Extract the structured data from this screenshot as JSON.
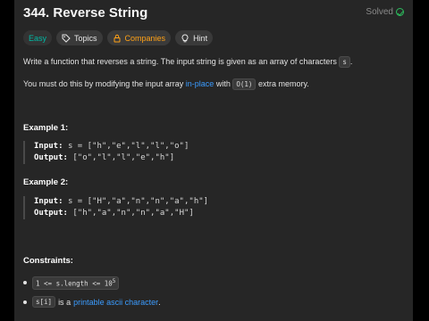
{
  "problem": {
    "title": "344. Reverse String",
    "status": "Solved"
  },
  "tags": {
    "difficulty": "Easy",
    "topics": "Topics",
    "companies": "Companies",
    "hint": "Hint"
  },
  "description": {
    "p1_text": "Write a function that reverses a string. The input string is given as an array of characters",
    "p1_code": "s",
    "p1_end": ".",
    "p2_text": "You must do this by modifying the input array",
    "p2_link": "in-place",
    "p2_mid": "with",
    "p2_code": "O(1)",
    "p2_end": "extra memory."
  },
  "examples": [
    {
      "title": "Example 1:",
      "input_label": "Input:",
      "input_value": "s = [\"h\",\"e\",\"l\",\"l\",\"o\"]",
      "output_label": "Output:",
      "output_value": "[\"o\",\"l\",\"l\",\"e\",\"h\"]"
    },
    {
      "title": "Example 2:",
      "input_label": "Input:",
      "input_value": "s = [\"H\",\"a\",\"n\",\"n\",\"a\",\"h\"]",
      "output_label": "Output:",
      "output_value": "[\"h\",\"a\",\"n\",\"n\",\"a\",\"H\"]"
    }
  ],
  "constraints": {
    "title": "Constraints:",
    "c1_code_base": "1 <= s.length <= 10",
    "c1_code_exp": "5",
    "c2_code": "s[i]",
    "c2_text": "is a",
    "c2_link": "printable ascii character",
    "c2_end": "."
  },
  "colors": {
    "accent_easy": "#00b8a3",
    "accent_companies": "#ffa116",
    "solved": "#2cbb5d",
    "link": "#3b9cff"
  }
}
